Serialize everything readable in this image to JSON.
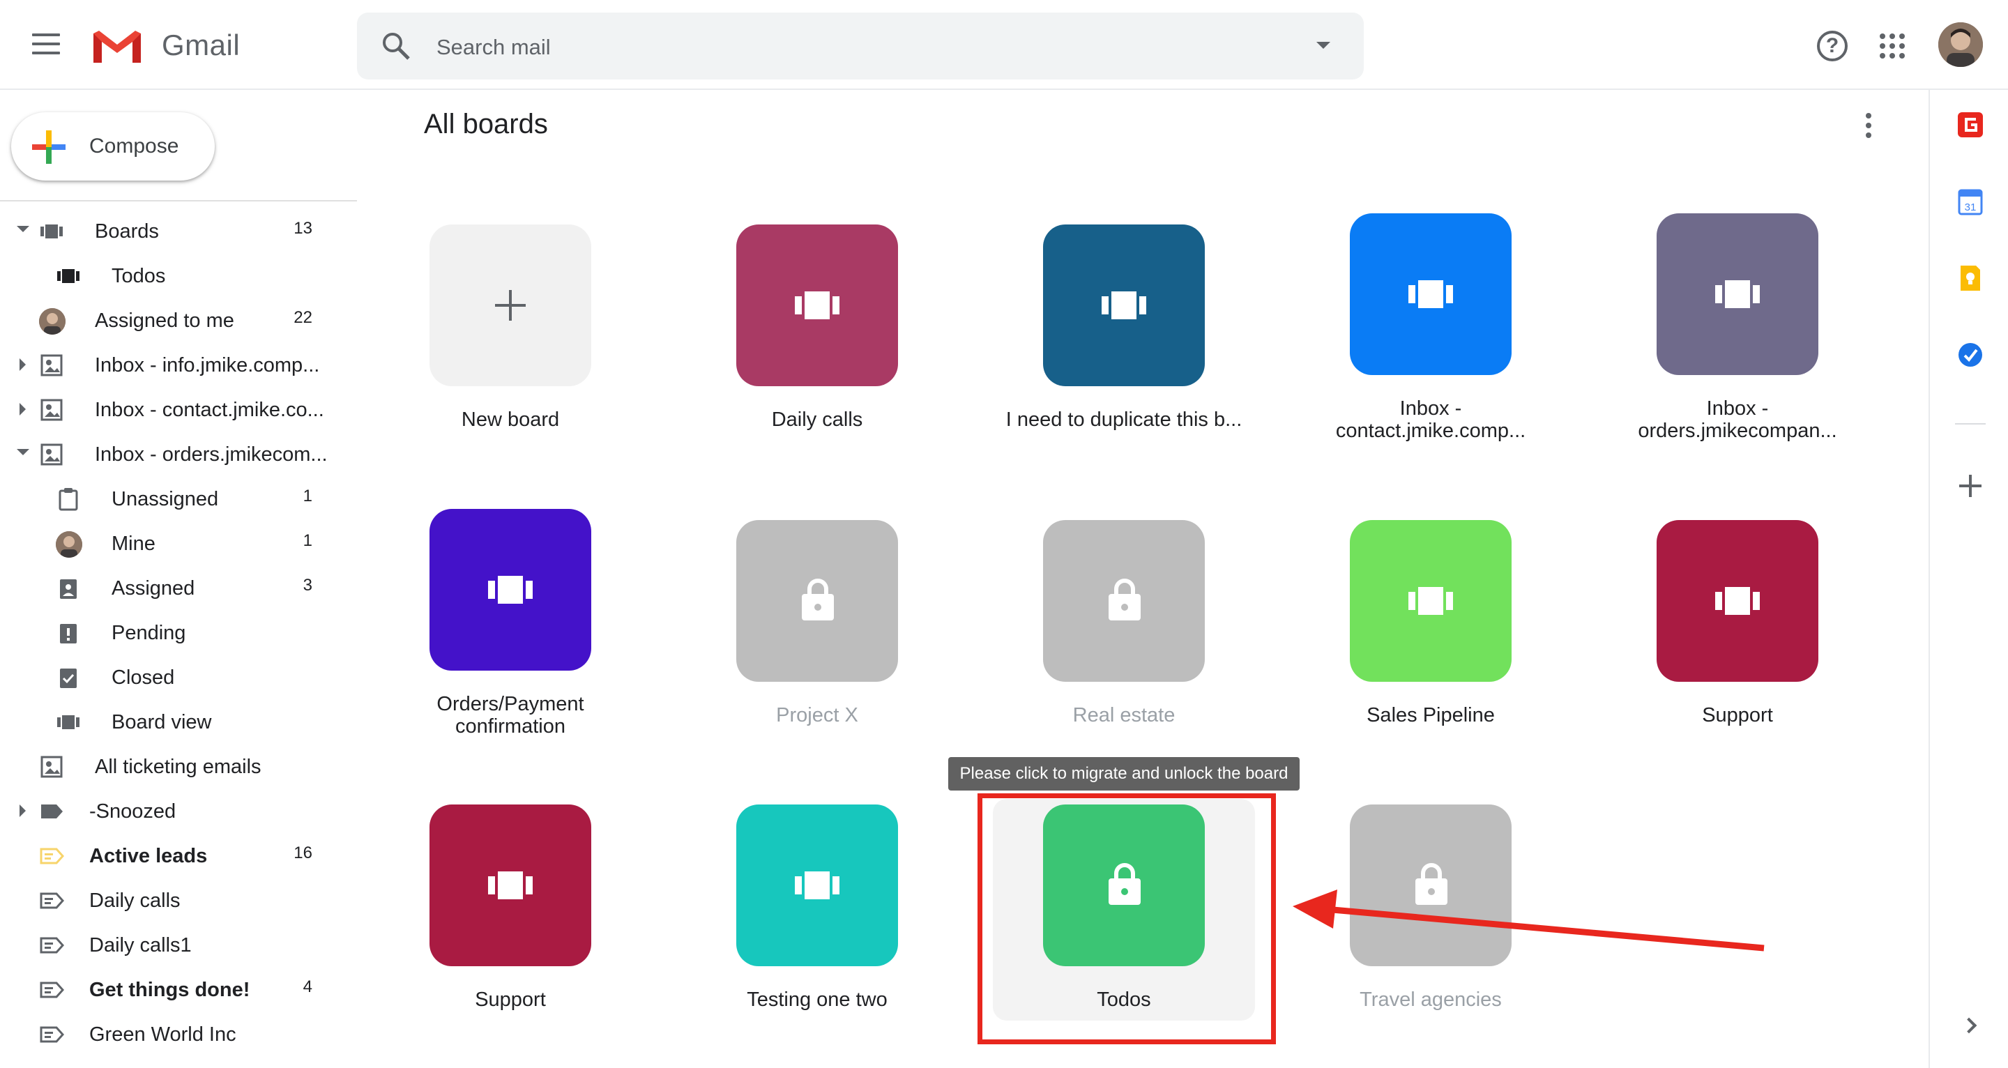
{
  "header": {
    "app_name": "Gmail",
    "search_placeholder": "Search mail",
    "help_icon": "help-circle-icon",
    "apps_icon": "apps-grid-icon"
  },
  "compose": {
    "label": "Compose"
  },
  "sidebar": {
    "items": [
      {
        "label": "Boards",
        "count": "13",
        "icon": "boards-icon",
        "expander": "expanded"
      },
      {
        "label": "Todos",
        "count": "",
        "icon": "board-icon"
      },
      {
        "label": "Assigned to me",
        "count": "22",
        "icon": "avatar"
      },
      {
        "label": "Inbox - info.jmike.comp...",
        "count": "",
        "icon": "shared-inbox-icon",
        "expander": "collapsed"
      },
      {
        "label": "Inbox - contact.jmike.co...",
        "count": "",
        "icon": "shared-inbox-icon",
        "expander": "collapsed"
      },
      {
        "label": "Inbox - orders.jmikecom...",
        "count": "",
        "icon": "shared-inbox-icon",
        "expander": "expanded"
      },
      {
        "label": "Unassigned",
        "count": "1",
        "icon": "clipboard-icon"
      },
      {
        "label": "Mine",
        "count": "1",
        "icon": "avatar"
      },
      {
        "label": "Assigned",
        "count": "3",
        "icon": "assigned-clipboard-icon"
      },
      {
        "label": "Pending",
        "count": "",
        "icon": "pending-clipboard-icon"
      },
      {
        "label": "Closed",
        "count": "",
        "icon": "closed-clipboard-icon"
      },
      {
        "label": "Board view",
        "count": "",
        "icon": "board-icon"
      },
      {
        "label": "All ticketing emails",
        "count": "",
        "icon": "shared-inbox-icon"
      },
      {
        "label": "-Snoozed",
        "count": "",
        "icon": "label-icon",
        "expander": "collapsed"
      },
      {
        "label": "Active leads",
        "count": "16",
        "icon": "label-tag-icon",
        "bold": true
      },
      {
        "label": "Daily calls",
        "count": "",
        "icon": "label-tag-icon"
      },
      {
        "label": "Daily calls1",
        "count": "",
        "icon": "label-tag-icon"
      },
      {
        "label": "Get things done!",
        "count": "4",
        "icon": "label-tag-icon",
        "bold": true
      },
      {
        "label": "Green World Inc",
        "count": "",
        "icon": "label-tag-icon"
      }
    ]
  },
  "main": {
    "title": "All boards",
    "tooltip": "Please click to migrate and unlock the board",
    "boards": [
      {
        "label": "New board",
        "color": "#f1f1f1",
        "icon": "plus-icon"
      },
      {
        "label": "Daily calls",
        "color": "#a93a64",
        "icon": "board-icon"
      },
      {
        "label": "I need to duplicate this b...",
        "color": "#17608a",
        "icon": "board-icon"
      },
      {
        "label": "Inbox -\ncontact.jmike.comp...",
        "color": "#0a7cf5",
        "icon": "board-icon"
      },
      {
        "label": "Inbox -\norders.jmikecompan...",
        "color": "#6f6a8b",
        "icon": "board-icon"
      },
      {
        "label": "Orders/Payment\nconfirmation",
        "color": "#4412c9",
        "icon": "board-icon"
      },
      {
        "label": "Project X",
        "color": "#bdbdbd",
        "icon": "lock-icon",
        "locked": true
      },
      {
        "label": "Real estate",
        "color": "#bdbdbd",
        "icon": "lock-icon",
        "locked": true
      },
      {
        "label": "Sales Pipeline",
        "color": "#72e15c",
        "icon": "board-icon"
      },
      {
        "label": "Support",
        "color": "#a91b42",
        "icon": "board-icon"
      },
      {
        "label": "Support",
        "color": "#a91b42",
        "icon": "board-icon"
      },
      {
        "label": "Testing one two",
        "color": "#17c7bd",
        "icon": "board-icon"
      },
      {
        "label": "Todos",
        "color": "#3bc574",
        "icon": "lock-icon"
      },
      {
        "label": "Travel agencies",
        "color": "#bdbdbd",
        "icon": "lock-icon",
        "locked": true
      }
    ]
  },
  "right_panel": {
    "icons": [
      "streak-icon",
      "calendar-icon",
      "keep-icon",
      "tasks-icon"
    ],
    "calendar_day": "31"
  },
  "colors": {
    "highlight_box": "#e8271e",
    "arrow": "#e8271e"
  }
}
